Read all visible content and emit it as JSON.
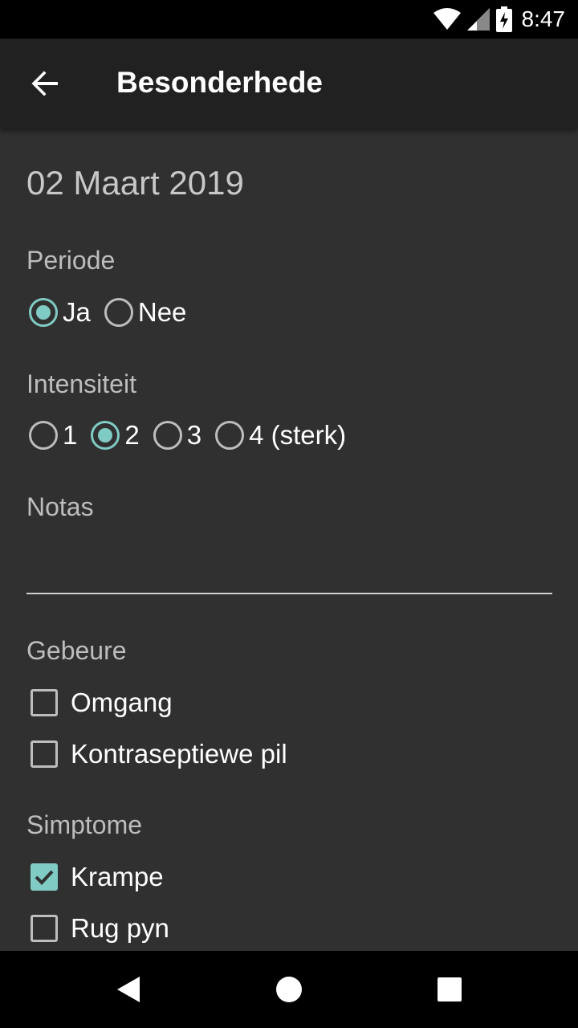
{
  "status_bar": {
    "time": "8:47",
    "icons": [
      "wifi-icon",
      "signal-icon",
      "battery-charging-icon"
    ]
  },
  "app_bar": {
    "title": "Besonderhede",
    "back_icon": "arrow-left-icon"
  },
  "date": "02 Maart 2019",
  "periode": {
    "label": "Periode",
    "options": [
      {
        "label": "Ja",
        "selected": true
      },
      {
        "label": "Nee",
        "selected": false
      }
    ]
  },
  "intensiteit": {
    "label": "Intensiteit",
    "options": [
      {
        "label": "1",
        "selected": false
      },
      {
        "label": "2",
        "selected": true
      },
      {
        "label": "3",
        "selected": false
      },
      {
        "label": "4 (sterk)",
        "selected": false
      }
    ]
  },
  "notas": {
    "label": "Notas",
    "value": ""
  },
  "gebeure": {
    "label": "Gebeure",
    "items": [
      {
        "label": "Omgang",
        "checked": false
      },
      {
        "label": "Kontraseptiewe pil",
        "checked": false
      }
    ]
  },
  "simptome": {
    "label": "Simptome",
    "items": [
      {
        "label": "Krampe",
        "checked": true
      },
      {
        "label": "Rug pyn",
        "checked": false
      }
    ]
  },
  "nav_bar": {
    "icons": [
      "back-triangle-icon",
      "home-circle-icon",
      "recents-square-icon"
    ]
  },
  "colors": {
    "accent": "#80cbc4",
    "background": "#303030",
    "app_bar": "#212121"
  }
}
